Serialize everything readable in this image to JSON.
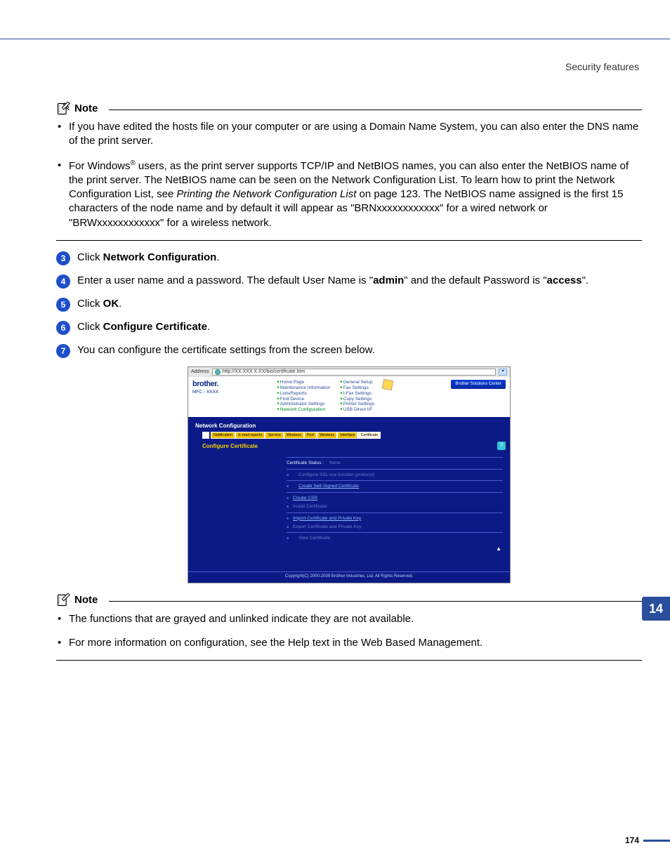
{
  "header": {
    "section_title": "Security features"
  },
  "chapter_tab": "14",
  "page_number": "174",
  "note1": {
    "label": "Note",
    "bullets": [
      "If you have edited the hosts file on your computer or are using a Domain Name System, you can also enter the DNS name of the print server.",
      "For Windows® users, as the print server supports TCP/IP and NetBIOS names, you can also enter the NetBIOS name of the print server. The NetBIOS name can be seen on the Network Configuration List. To learn how to print the Network Configuration List, see Printing the Network Configuration List on page 123. The NetBIOS name assigned is the first 15 characters of the node name and by default it will appear as \"BRNxxxxxxxxxxxx\" for a wired network or \"BRWxxxxxxxxxxxx\" for a wireless network."
    ]
  },
  "steps": {
    "s3": {
      "num": "3",
      "pre": "Click ",
      "bold": "Network Configuration",
      "post": "."
    },
    "s4": {
      "num": "4",
      "line": "Enter a user name and a password. The default User Name is \"",
      "b1": "admin",
      "mid": "\" and the default Password is \"",
      "b2": "access",
      "end": "\"."
    },
    "s5": {
      "num": "5",
      "pre": "Click ",
      "bold": "OK",
      "post": "."
    },
    "s6": {
      "num": "6",
      "pre": "Click ",
      "bold": "Configure Certificate",
      "post": "."
    },
    "s7": {
      "num": "7",
      "text": "You can configure the certificate settings from the screen below."
    }
  },
  "embed": {
    "address_label": "Address",
    "url": "http://XX.XXX.X.XX/bio/certificate.htm",
    "brand": "brother.",
    "model": "MFC - XXXX",
    "nav_col1": [
      "Home Page",
      "Maintenance Information",
      "Lists/Reports",
      "Find Device",
      "Administrator Settings",
      "Network Configuration"
    ],
    "nav_col2": [
      "General Setup",
      "Fax Settings",
      "I-Fax Settings",
      "Copy Settings",
      "Printer Settings",
      "USB Direct I/F"
    ],
    "solutions_center": "Brother Solutions Center",
    "section_title": "Network Configuration",
    "tabs": [
      "Notification",
      "E-mail reports",
      "Service",
      "Wireless",
      "Port",
      "Wireless",
      "Interface",
      "Certificate"
    ],
    "panel_title": "Configure Certificate",
    "status_label": "Certificate Status :",
    "status_value": "None",
    "items": {
      "config_ssl": "Configure SSL use function (protocol)",
      "create_self": "Create Self-Signed Certificate",
      "create_csr": "Create CSR",
      "install_cert": "Install Certificate",
      "import_cert": "Import Certificate and Private Key",
      "export_cert": "Export Certificate and Private Key",
      "view_cert": "View Certificate"
    },
    "copyright": "Copyright(C) 2000-2009 Brother Industries, Ltd. All Rights Reserved."
  },
  "note2": {
    "label": "Note",
    "bullets": [
      "The functions that are grayed and unlinked indicate they are not available.",
      "For more information on configuration, see the Help text in the Web Based Management."
    ]
  }
}
